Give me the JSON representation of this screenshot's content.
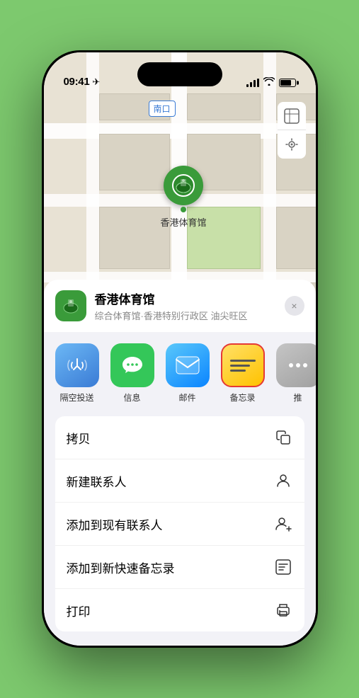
{
  "status_bar": {
    "time": "09:41",
    "location_icon": "▶"
  },
  "map": {
    "label": "南口",
    "venue_name": "香港体育馆",
    "venue_emoji": "🏟️"
  },
  "map_controls": {
    "map_icon": "🗺",
    "location_icon": "⬆"
  },
  "venue_card": {
    "name": "香港体育馆",
    "description": "综合体育馆·香港特别行政区 油尖旺区",
    "close_label": "×"
  },
  "share_apps": [
    {
      "id": "airdrop",
      "label": "隔空投送",
      "icon_type": "airdrop"
    },
    {
      "id": "messages",
      "label": "信息",
      "icon_type": "messages"
    },
    {
      "id": "mail",
      "label": "邮件",
      "icon_type": "mail"
    },
    {
      "id": "notes",
      "label": "备忘录",
      "icon_type": "notes"
    },
    {
      "id": "more",
      "label": "推",
      "icon_type": "more"
    }
  ],
  "actions": [
    {
      "id": "copy",
      "label": "拷贝",
      "icon": "⧉"
    },
    {
      "id": "new-contact",
      "label": "新建联系人",
      "icon": "👤"
    },
    {
      "id": "add-existing",
      "label": "添加到现有联系人",
      "icon": "👤+"
    },
    {
      "id": "add-notes",
      "label": "添加到新快速备忘录",
      "icon": "📝"
    },
    {
      "id": "print",
      "label": "打印",
      "icon": "🖨"
    }
  ],
  "more_indicator_colors": [
    "#e53935",
    "#ff9800",
    "#4caf50",
    "#2196f3",
    "#9c27b0"
  ]
}
